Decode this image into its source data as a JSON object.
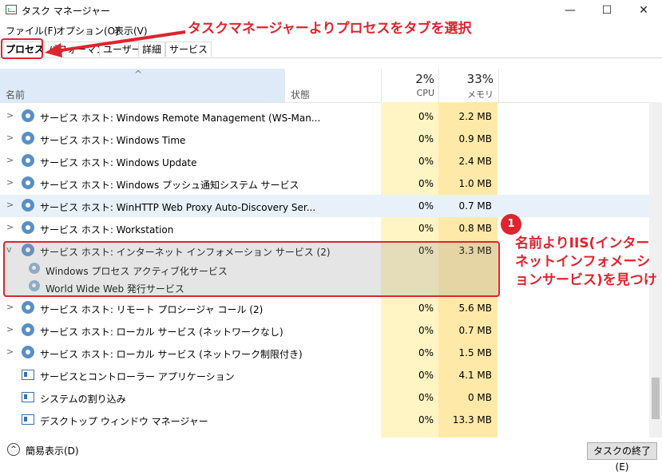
{
  "window": {
    "title": "タスク マネージャー",
    "minimize": "—",
    "maximize": "☐",
    "close": "✕"
  },
  "menu": [
    "ファイル(F)",
    "オプション(O)",
    "表示(V)"
  ],
  "tabs": [
    "プロセス",
    "パフォーマンス",
    "ユーザー",
    "詳細",
    "サービス"
  ],
  "header": {
    "name": "名前",
    "status": "状態",
    "cpu_pct": "2%",
    "cpu": "CPU",
    "mem_pct": "33%",
    "mem": "メモリ"
  },
  "rows": [
    {
      "name": "サービス ホスト: Windows Remote Management (WS-Man...",
      "cpu": "0%",
      "mem": "2.2 MB"
    },
    {
      "name": "サービス ホスト: Windows Time",
      "cpu": "0%",
      "mem": "0.9 MB"
    },
    {
      "name": "サービス ホスト: Windows Update",
      "cpu": "0%",
      "mem": "2.4 MB"
    },
    {
      "name": "サービス ホスト: Windows プッシュ通知システム サービス",
      "cpu": "0%",
      "mem": "1.0 MB"
    },
    {
      "name": "サービス ホスト: WinHTTP Web Proxy Auto-Discovery Ser...",
      "cpu": "0%",
      "mem": "0.7 MB"
    },
    {
      "name": "サービス ホスト: Workstation",
      "cpu": "0%",
      "mem": "0.8 MB"
    },
    {
      "name": "サービス ホスト: インターネット インフォメーション サービス (2)",
      "cpu": "0%",
      "mem": "3.3 MB"
    },
    {
      "name": "Windows プロセス アクティブ化サービス",
      "cpu": "",
      "mem": ""
    },
    {
      "name": "World Wide Web 発行サービス",
      "cpu": "",
      "mem": ""
    },
    {
      "name": "サービス ホスト: リモート プロシージャ コール (2)",
      "cpu": "0%",
      "mem": "5.6 MB"
    },
    {
      "name": "サービス ホスト: ローカル サービス (ネットワークなし)",
      "cpu": "0%",
      "mem": "0.7 MB"
    },
    {
      "name": "サービス ホスト: ローカル サービス (ネットワーク制限付き)",
      "cpu": "0%",
      "mem": "1.5 MB"
    },
    {
      "name": "サービスとコントローラー アプリケーション",
      "cpu": "0%",
      "mem": "4.1 MB"
    },
    {
      "name": "システムの割り込み",
      "cpu": "0%",
      "mem": "0 MB"
    },
    {
      "name": "デスクトップ ウィンドウ マネージャー",
      "cpu": "0%",
      "mem": "13.3 MB"
    }
  ],
  "footer": {
    "fewer_details": "簡易表示(D)",
    "end_task": "タスクの終了(E)"
  },
  "annotations": {
    "top": "タスクマネージャーよりプロセスをタブを選択",
    "badge": "1",
    "right": "名前よりIIS(インターネットインフォメーションサービス)を見つけ"
  }
}
